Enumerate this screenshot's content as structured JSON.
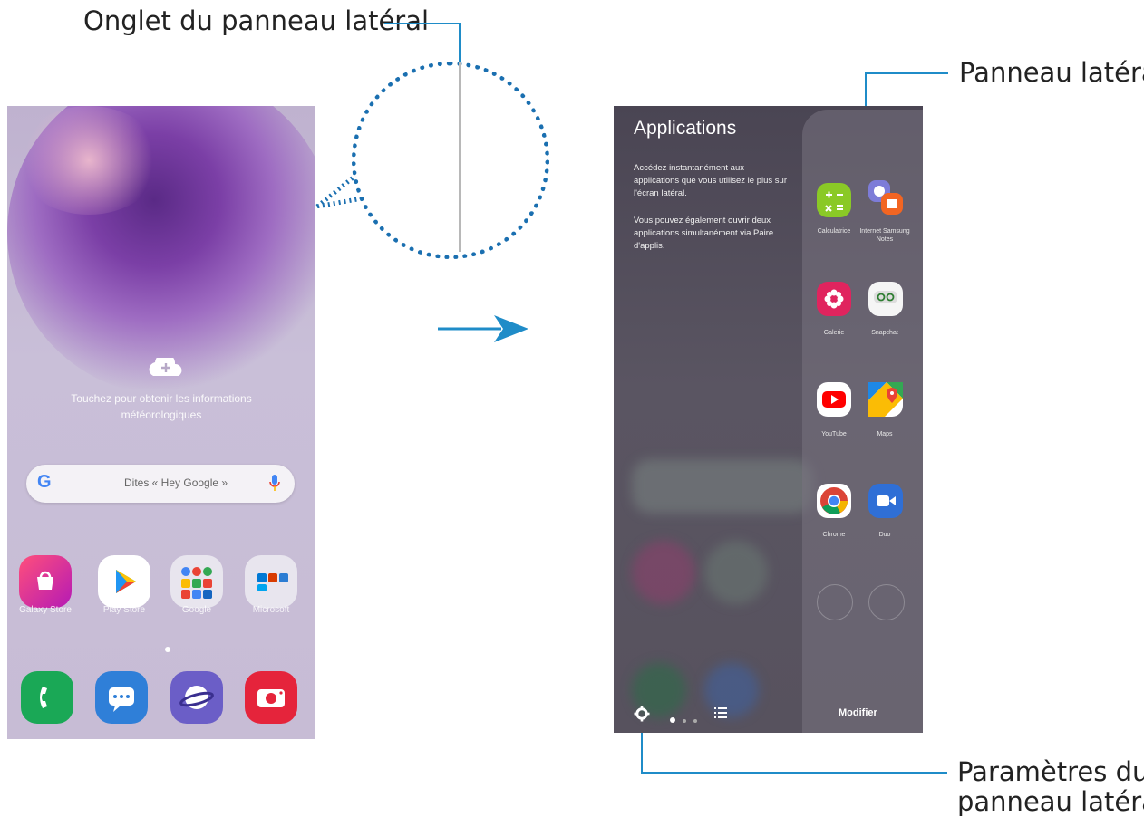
{
  "callouts": {
    "tab_label": "Onglet du panneau latéral",
    "panel_label": "Panneau latéral",
    "settings_label_line1": "Paramètres du",
    "settings_label_line2": "panneau latéral"
  },
  "home_screen": {
    "weather_text": "Touchez pour obtenir les informations météorologiques",
    "search_placeholder": "Dites « Hey Google »",
    "search_logo": "G",
    "apps": [
      {
        "label": "Galaxy Store",
        "icon": "galaxy-store-icon"
      },
      {
        "label": "Play Store",
        "icon": "play-store-icon"
      },
      {
        "label": "Google",
        "icon": "google-folder-icon"
      },
      {
        "label": "Microsoft",
        "icon": "microsoft-folder-icon"
      }
    ],
    "dock": [
      {
        "icon": "phone-icon"
      },
      {
        "icon": "messages-icon"
      },
      {
        "icon": "internet-icon"
      },
      {
        "icon": "camera-icon"
      }
    ]
  },
  "edge_screen": {
    "title": "Applications",
    "description_1": "Accédez instantanément aux applications que vous utilisez le plus sur l'écran latéral.",
    "description_2": "Vous pouvez également ouvrir deux applications simultanément via Paire d'applis.",
    "edge_apps": [
      {
        "label": "Calculatrice",
        "icon": "calculator-icon"
      },
      {
        "label": "Internet Samsung Notes",
        "icon": "internet-notes-pair-icon"
      },
      {
        "label": "Galerie",
        "icon": "gallery-icon"
      },
      {
        "label": "Snapchat",
        "icon": "snap-icon"
      },
      {
        "label": "YouTube",
        "icon": "youtube-icon"
      },
      {
        "label": "Maps",
        "icon": "maps-icon"
      },
      {
        "label": "Chrome",
        "icon": "chrome-icon"
      },
      {
        "label": "Duo",
        "icon": "duo-icon"
      }
    ],
    "edit_label": "Modifier"
  },
  "colors": {
    "callout_line": "#1f8cc8",
    "magnifier": "#1a6fb0"
  }
}
